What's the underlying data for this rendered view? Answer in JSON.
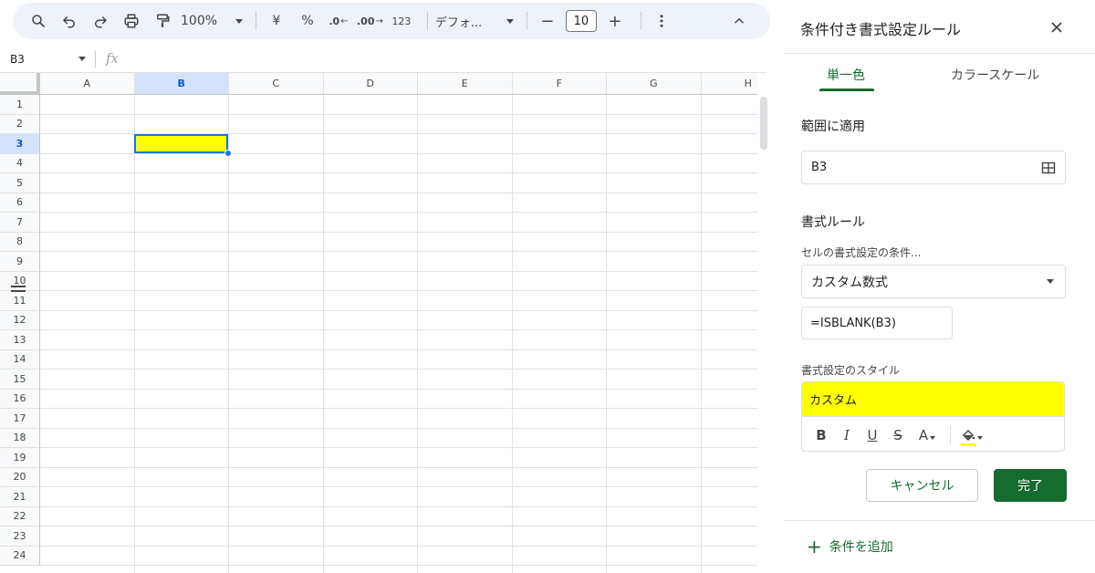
{
  "toolbar": {
    "zoom": "100%",
    "currency": "¥",
    "percent": "%",
    "decimal_decrease": ".0",
    "decimal_increase": ".00",
    "number_format": "123",
    "font": "デフォ...",
    "font_size_minus": "−",
    "font_size": "10",
    "font_size_plus": "+",
    "icons": [
      "search-icon",
      "undo-icon",
      "redo-icon",
      "print-icon",
      "paint-format-icon",
      "more-vert-icon",
      "chevron-up-icon"
    ]
  },
  "formula_bar": {
    "name_box": "B3",
    "fx": "fx"
  },
  "grid": {
    "columns": [
      "A",
      "B",
      "C",
      "D",
      "E",
      "F",
      "G",
      "H"
    ],
    "active_column": "B",
    "rows": [
      "1",
      "2",
      "3",
      "4",
      "5",
      "6",
      "7",
      "8",
      "9",
      "10",
      "11",
      "12",
      "13",
      "14",
      "15",
      "16",
      "17",
      "18",
      "19",
      "20",
      "21",
      "22",
      "23",
      "24"
    ],
    "active_row": "3",
    "selected_cell": "B3",
    "selected_cell_fill": "#ffff00"
  },
  "panel": {
    "title": "条件付き書式設定ルール",
    "tabs": {
      "single": "単一色",
      "color_scale": "カラースケール"
    },
    "range_label": "範囲に適用",
    "range_value": "B3",
    "rules_label": "書式ルール",
    "condition_label": "セルの書式設定の条件...",
    "condition_value": "カスタム数式",
    "formula_value": "=ISBLANK(B3)",
    "style_label": "書式設定のスタイル",
    "style_preview": "カスタム",
    "style_fill": "#ffff00",
    "format_buttons": {
      "bold": "B",
      "italic": "I",
      "underline": "U",
      "strike": "S",
      "text_color": "A"
    },
    "cancel": "キャンセル",
    "done": "完了",
    "add_condition_plus": "+",
    "add_condition": "条件を追加",
    "accent_color": "#146c2e"
  }
}
